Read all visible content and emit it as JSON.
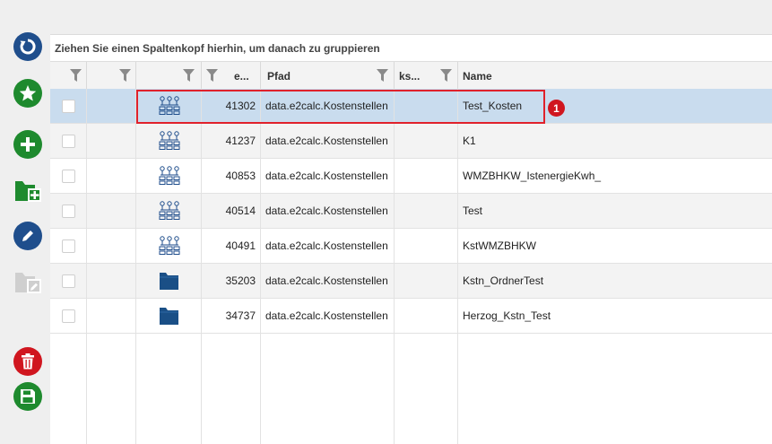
{
  "toolbar": {
    "buttons": [
      {
        "icon": "refresh-icon",
        "color": "#1f4e8c"
      },
      {
        "icon": "star-icon",
        "color": "#1e8a2e"
      },
      {
        "icon": "plus-icon",
        "color": "#1e8a2e"
      },
      {
        "icon": "folder-add-icon",
        "color": "#1e8a2e"
      },
      {
        "icon": "edit-icon",
        "color": "#1f4e8c"
      },
      {
        "icon": "folder-edit-icon",
        "color": "#c8c8c8"
      },
      {
        "icon": "trash-icon",
        "color": "#d0161f"
      },
      {
        "icon": "save-icon",
        "color": "#1e8a2e"
      }
    ]
  },
  "group_bar": {
    "text": "Ziehen Sie einen Spaltenkopf hierhin, um danach zu gruppieren"
  },
  "columns": {
    "id": "e...",
    "path": "Pfad",
    "ks": "ks...",
    "name": "Name"
  },
  "rows": [
    {
      "icon": "network-icon",
      "id": "41302",
      "path": "data.e2calc.Kostenstellen",
      "ks": "",
      "name": "Test_Kosten"
    },
    {
      "icon": "network-icon",
      "id": "41237",
      "path": "data.e2calc.Kostenstellen",
      "ks": "",
      "name": "K1"
    },
    {
      "icon": "network-icon",
      "id": "40853",
      "path": "data.e2calc.Kostenstellen",
      "ks": "",
      "name": "WMZBHKW_IstenergieKwh_"
    },
    {
      "icon": "network-icon",
      "id": "40514",
      "path": "data.e2calc.Kostenstellen",
      "ks": "",
      "name": "Test"
    },
    {
      "icon": "network-icon",
      "id": "40491",
      "path": "data.e2calc.Kostenstellen",
      "ks": "",
      "name": "KstWMZBHKW"
    },
    {
      "icon": "folder-icon",
      "id": "35203",
      "path": "data.e2calc.Kostenstellen",
      "ks": "",
      "name": "Kstn_OrdnerTest"
    },
    {
      "icon": "folder-icon",
      "id": "34737",
      "path": "data.e2calc.Kostenstellen",
      "ks": "",
      "name": "Herzog_Kstn_Test"
    }
  ],
  "annotation": {
    "number": "1",
    "color": "#d0161f"
  }
}
